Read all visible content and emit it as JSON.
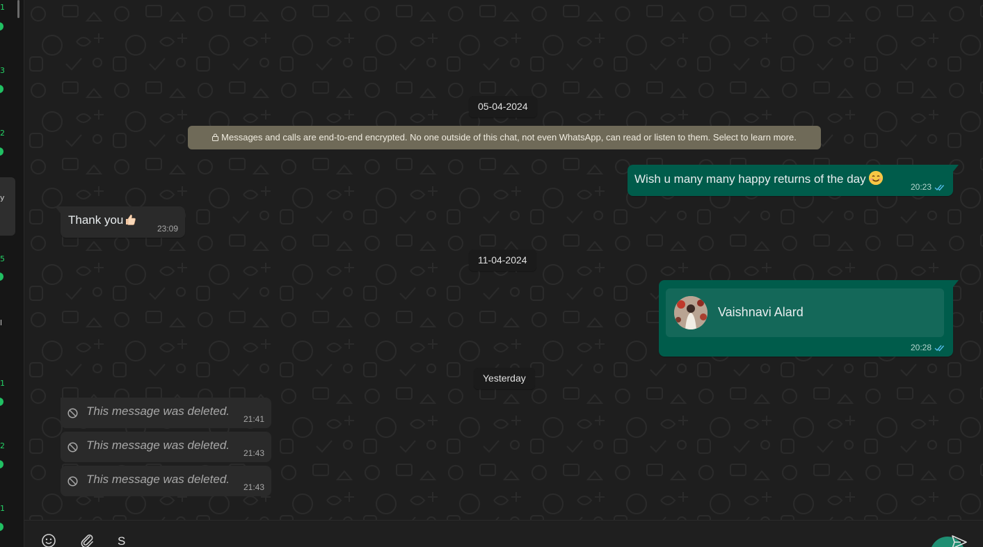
{
  "sidebar": {
    "badges": [
      "1",
      "3",
      "2",
      "5",
      "1",
      "2",
      "1"
    ],
    "selected_char": "y",
    "cut_char": "l"
  },
  "dates": {
    "first": "05-04-2024",
    "second": "11-04-2024",
    "third": "Yesterday"
  },
  "encryption_notice": "Messages and calls are end-to-end encrypted. No one outside of this chat, not even WhatsApp, can read or listen to them. Select to learn more.",
  "messages": [
    {
      "direction": "out",
      "text": "Wish u many many happy returns of the day",
      "emoji": "smiling-face",
      "time": "20:23"
    },
    {
      "direction": "in",
      "text": "Thank you",
      "emoji": "thumbs-up",
      "time": "23:09"
    },
    {
      "direction": "out",
      "type": "contact",
      "contact_name": "Vaishnavi Alard",
      "time": "20:28"
    },
    {
      "direction": "in",
      "type": "deleted",
      "text": "This message was deleted.",
      "time": "21:41"
    },
    {
      "direction": "in",
      "type": "deleted",
      "text": "This message was deleted.",
      "time": "21:43"
    },
    {
      "direction": "in",
      "type": "deleted",
      "text": "This message was deleted.",
      "time": "21:43"
    }
  ],
  "composer": {
    "draft": "S"
  },
  "colors": {
    "outgoing_bubble": "#005c4b",
    "incoming_bubble": "#2a2a2a",
    "notice": "#6f6a58",
    "accent": "#25d366",
    "read_tick": "#53bdeb"
  }
}
